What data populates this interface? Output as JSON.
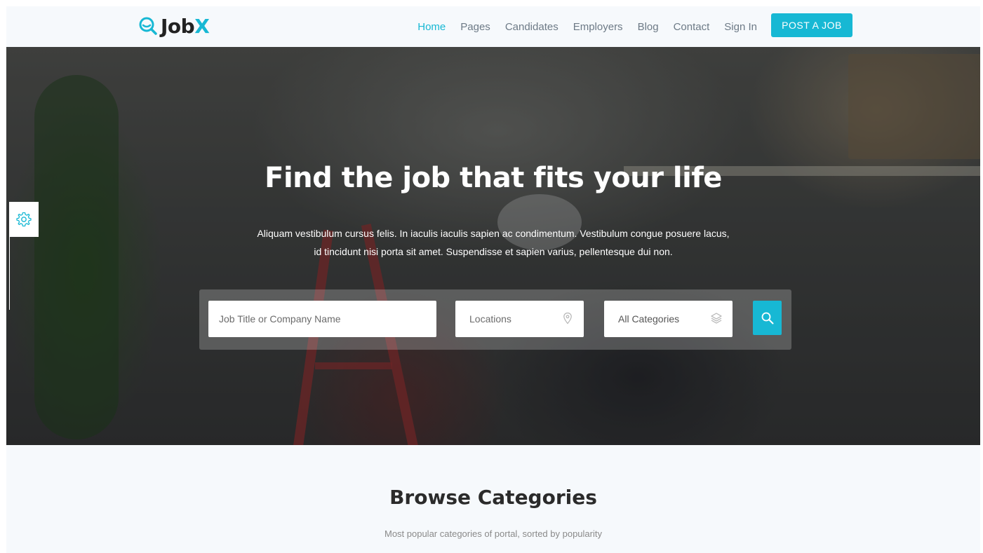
{
  "brand": {
    "name_main": "Job",
    "name_accent": "X",
    "accent_color": "#17b8d4"
  },
  "nav": {
    "items": [
      {
        "label": "Home",
        "active": true
      },
      {
        "label": "Pages",
        "active": false
      },
      {
        "label": "Candidates",
        "active": false
      },
      {
        "label": "Employers",
        "active": false
      },
      {
        "label": "Blog",
        "active": false
      },
      {
        "label": "Contact",
        "active": false
      },
      {
        "label": "Sign In",
        "active": false
      }
    ],
    "cta_label": "POST A JOB"
  },
  "hero": {
    "title": "Find the job that fits your life",
    "description_line1": "Aliquam vestibulum cursus felis. In iaculis iaculis sapien ac condimentum. Vestibulum congue posuere lacus,",
    "description_line2": "id tincidunt nisi porta sit amet. Suspendisse et sapien varius, pellentesque dui non."
  },
  "search": {
    "job_placeholder": "Job Title or Company Name",
    "location_placeholder": "Locations",
    "category_value": "All Categories",
    "icons": {
      "location": "map-pin-icon",
      "category": "layers-icon",
      "submit": "search-icon"
    }
  },
  "side_tool": {
    "icon": "gear-icon"
  },
  "categories_section": {
    "title": "Browse Categories",
    "subtitle": "Most popular categories of portal, sorted by popularity"
  }
}
